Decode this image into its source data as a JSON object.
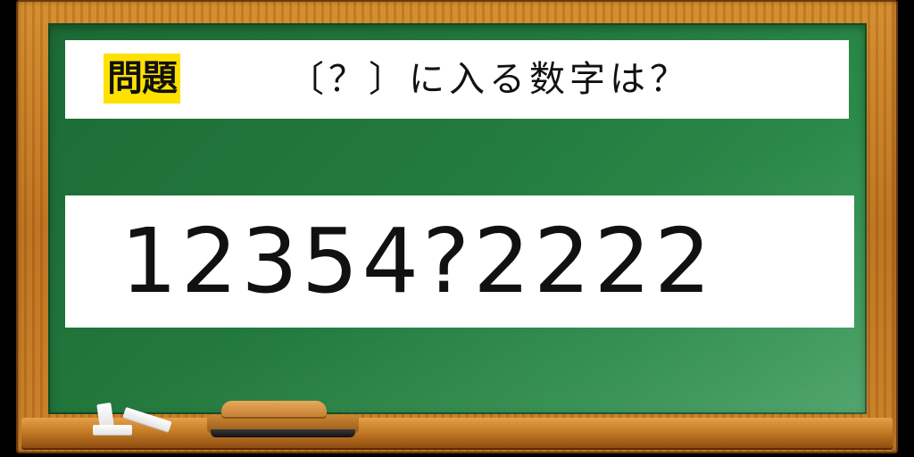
{
  "question": {
    "tag": "問題",
    "text": "〔？〕に入る数字は？"
  },
  "puzzle": {
    "sequence": "12354?2222"
  },
  "colors": {
    "board": "#237a3e",
    "frame": "#c67d25",
    "tag_highlight": "#ffe100",
    "panel": "#ffffff",
    "text": "#111111"
  }
}
